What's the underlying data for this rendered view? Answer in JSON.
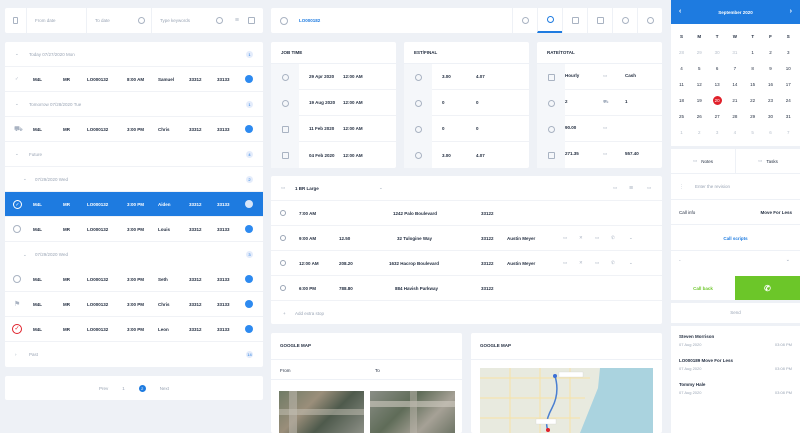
{
  "filter": {
    "from_placeholder": "From date",
    "to_placeholder": "To date",
    "keyword_placeholder": "Type keywords"
  },
  "list": {
    "groups": [
      {
        "label": "Today 07/27/2020 Mon",
        "count": "1"
      },
      {
        "label": "Tomorrow 07/28/2020 Tue",
        "count": "1"
      },
      {
        "label": "Future",
        "count": "4"
      },
      {
        "label": "07/29/2020 Wed",
        "count": "2"
      },
      {
        "label": "07/29/2020 Wed",
        "count": "3"
      },
      {
        "label": "Past",
        "count": "14"
      }
    ],
    "rows": [
      {
        "c1": "M4L",
        "c2": "MR",
        "id": "LO000132",
        "time": "8:00 AM",
        "name": "Samuel",
        "n1": "33312",
        "n2": "33133"
      },
      {
        "c1": "M4L",
        "c2": "MR",
        "id": "LO000132",
        "time": "3:00 PM",
        "name": "Chris",
        "n1": "33312",
        "n2": "33133"
      },
      {
        "c1": "M4L",
        "c2": "MR",
        "id": "LO000132",
        "time": "3:00 PM",
        "name": "Aiden",
        "n1": "33312",
        "n2": "33133"
      },
      {
        "c1": "M4L",
        "c2": "MR",
        "id": "LO000132",
        "time": "3:00 PM",
        "name": "Louis",
        "n1": "33312",
        "n2": "33133"
      },
      {
        "c1": "M4L",
        "c2": "MR",
        "id": "LO000132",
        "time": "3:00 PM",
        "name": "Seth",
        "n1": "33312",
        "n2": "33133"
      },
      {
        "c1": "M4L",
        "c2": "MR",
        "id": "LO000132",
        "time": "3:00 PM",
        "name": "Chris",
        "n1": "33312",
        "n2": "33133"
      },
      {
        "c1": "M4L",
        "c2": "MR",
        "id": "LO000132",
        "time": "3:00 PM",
        "name": "Leon",
        "n1": "33312",
        "n2": "33133"
      }
    ]
  },
  "pager": {
    "prev": "Prev",
    "page1": "1",
    "current": "2",
    "next": "Next"
  },
  "toolbar": {
    "job_id": "LO000182"
  },
  "job_time": {
    "title": "JOB TIME",
    "rows": [
      {
        "date": "29 Apr 2020",
        "time": "12:00 AM"
      },
      {
        "date": "19 Aug 2020",
        "time": "12:00 AM"
      },
      {
        "date": "11 Feb 2020",
        "time": "12:00 AM"
      },
      {
        "date": "04 Feb 2020",
        "time": "12:00 AM"
      }
    ]
  },
  "est": {
    "title": "EST/FINAL",
    "rows": [
      {
        "a": "3.00",
        "b": "4.07"
      },
      {
        "a": "0",
        "b": "0"
      },
      {
        "a": "0",
        "b": "0"
      },
      {
        "a": "3.00",
        "b": "4.07"
      }
    ]
  },
  "rate": {
    "title": "RATE/TOTAL",
    "rows": [
      {
        "a": "Hourly",
        "b": "Cash"
      },
      {
        "a": "2",
        "b": "1"
      },
      {
        "a": "90.00",
        "b": ""
      },
      {
        "a": "271.35",
        "b": "557.40"
      }
    ]
  },
  "route": {
    "truck": "1 BR Large",
    "rows": [
      {
        "time": "7:00 AM",
        "v": "",
        "addr": "1242 Palo Boulevard",
        "zip": "33122",
        "who": ""
      },
      {
        "time": "9:00 AM",
        "v": "12.50",
        "addr": "32 Tulogine Way",
        "zip": "33122",
        "who": "Austin Meyer"
      },
      {
        "time": "12:00 AM",
        "v": "208.20",
        "addr": "1632 Hacrop Boulevard",
        "zip": "33122",
        "who": "Austin Meyer"
      },
      {
        "time": "6:00 PM",
        "v": "788.80",
        "addr": "884 Havish Parkway",
        "zip": "33122",
        "who": ""
      }
    ],
    "add": "Add extra stop"
  },
  "map1": {
    "title": "GOOGLE MAP",
    "from": "From",
    "to": "To"
  },
  "map2": {
    "title": "GOOGLE MAP"
  },
  "calendar": {
    "month": "September 2020",
    "weekdays": [
      "S",
      "M",
      "T",
      "W",
      "T",
      "F",
      "S"
    ],
    "weeks": [
      [
        "28",
        "29",
        "30",
        "31",
        "1",
        "2",
        "3"
      ],
      [
        "4",
        "5",
        "6",
        "7",
        "8",
        "9",
        "10"
      ],
      [
        "11",
        "12",
        "13",
        "14",
        "15",
        "16",
        "17"
      ],
      [
        "18",
        "19",
        "20",
        "21",
        "22",
        "23",
        "24"
      ],
      [
        "25",
        "26",
        "27",
        "28",
        "29",
        "30",
        "31"
      ],
      [
        "1",
        "2",
        "3",
        "4",
        "5",
        "6",
        "7"
      ]
    ],
    "today": "20"
  },
  "side": {
    "notes": "Notes",
    "tasks": "Tasks",
    "review_placeholder": "Enter the revision",
    "call_info": "Call info",
    "move_for_less": "Move For Less",
    "call_scripts": "Call scripts",
    "call_back": "Call back",
    "send": "Send",
    "log": [
      {
        "name": "Steven Morrison",
        "date": "07 Aug 2020",
        "time": "03:08 PM"
      },
      {
        "name": "LO000189 Move For Less",
        "date": "07 Aug 2020",
        "time": "03:08 PM"
      },
      {
        "name": "Tommy Hale",
        "date": "07 Aug 2020",
        "time": "03:08 PM"
      }
    ]
  },
  "colors": {
    "accent": "#1e7be0",
    "green": "#6cc629",
    "today": "#e0202a"
  }
}
